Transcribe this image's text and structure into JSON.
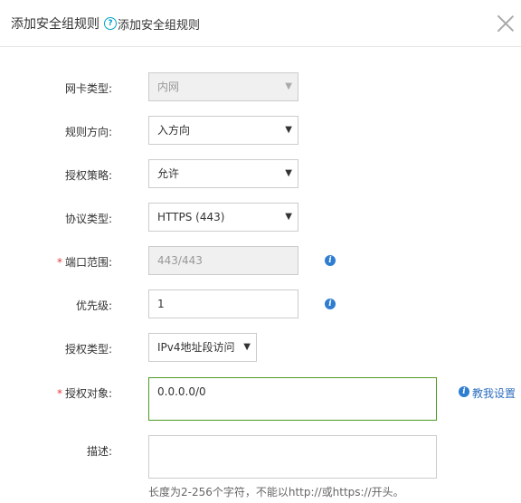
{
  "dialog": {
    "title": "添加安全组规则",
    "help_glyph": "?",
    "subtitle": "添加安全组规则",
    "close_icon": "close-icon"
  },
  "form": {
    "nic_type": {
      "label": "网卡类型:",
      "value": "内网"
    },
    "direction": {
      "label": "规则方向:",
      "value": "入方向"
    },
    "policy": {
      "label": "授权策略:",
      "value": "允许"
    },
    "protocol": {
      "label": "协议类型:",
      "value": "HTTPS (443)"
    },
    "port_range": {
      "required_mark": "*",
      "label": "端口范围:",
      "value": "443/443"
    },
    "priority": {
      "label": "优先级:",
      "value": "1"
    },
    "auth_type": {
      "label": "授权类型:",
      "value": "IPv4地址段访问"
    },
    "auth_object": {
      "required_mark": "*",
      "label": "授权对象:",
      "value": "0.0.0.0/0",
      "help_link": "教我设置"
    },
    "description": {
      "label": "描述:",
      "value": "",
      "hint": "长度为2-256个字符，不能以http://或https://开头。"
    }
  },
  "colors": {
    "accent_link": "#2e6fbf",
    "active_border": "#4e9a26",
    "required": "#e4393c",
    "info_icon": "#2e7dd1"
  }
}
